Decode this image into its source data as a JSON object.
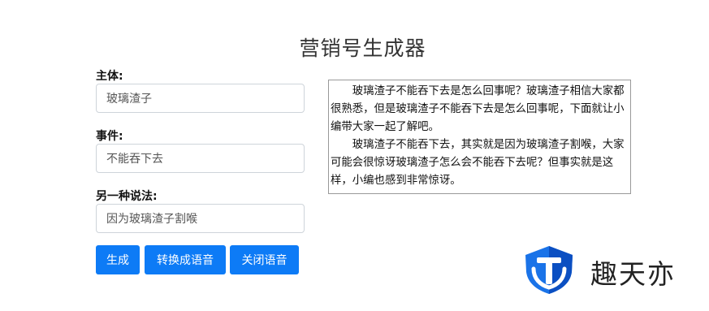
{
  "page": {
    "title": "营销号生成器"
  },
  "form": {
    "subject": {
      "label": "主体:",
      "value": "玻璃渣子"
    },
    "event": {
      "label": "事件:",
      "value": "不能吞下去"
    },
    "alt": {
      "label": "另一种说法:",
      "value": "因为玻璃渣子割喉"
    }
  },
  "buttons": {
    "generate": "生成",
    "to_speech": "转换成语音",
    "close_speech": "关闭语音"
  },
  "output": {
    "paragraphs": [
      "玻璃渣子不能吞下去是怎么回事呢？玻璃渣子相信大家都很熟悉，但是玻璃渣子不能吞下去是怎么回事呢，下面就让小编带大家一起了解吧。",
      "玻璃渣子不能吞下去，其实就是因为玻璃渣子割喉，大家可能会很惊讶玻璃渣子怎么会不能吞下去呢？但事实就是这样，小编也感到非常惊讶。"
    ]
  },
  "watermark": {
    "text": "趣天亦",
    "colors": {
      "shield_blue": "#1a73e8",
      "shield_dark": "#0b4fc2",
      "button_blue": "#0d7bf6"
    }
  }
}
